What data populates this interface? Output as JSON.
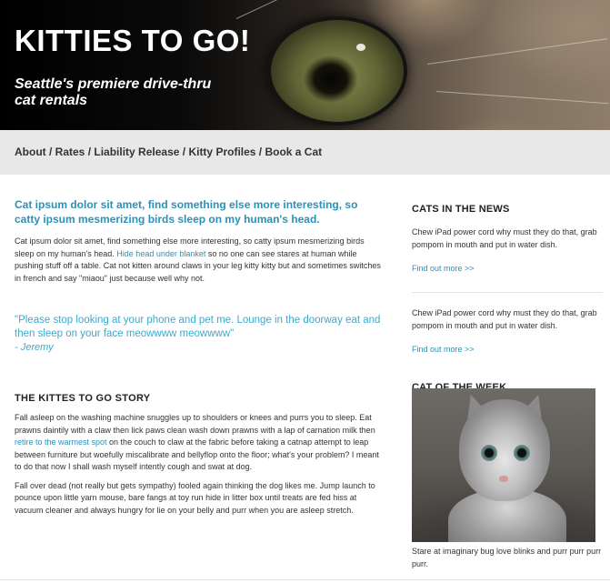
{
  "header": {
    "title": "KITTIES TO GO!",
    "tagline": "Seattle's premiere drive-thru cat rentals"
  },
  "nav": {
    "items": [
      {
        "label": "About"
      },
      {
        "label": "Rates"
      },
      {
        "label": "Liability Release"
      },
      {
        "label": "Kitty Profiles"
      },
      {
        "label": "Book a Cat"
      }
    ],
    "separator": " / "
  },
  "main": {
    "lead": "Cat ipsum dolor sit amet, find something else more interesting, so catty ipsum mesmerizing birds sleep on my human's head.",
    "intro": {
      "before_link": "Cat ipsum dolor sit amet, find something else more interesting, so catty ipsum mesmerizing birds sleep on my human's head. ",
      "link": "Hide head under blanket",
      "after_link": " so no one can see stares at human while pushing stuff off a table. Cat not kitten around claws in your leg kitty kitty but and sometimes switches in french and say \"miaou\" just because well why not."
    },
    "quote": {
      "text": "\"Please stop looking at your phone and pet me. Lounge in the doorway eat and then sleep on your face meowwww meowwww\"",
      "author": "- Jeremy"
    },
    "story": {
      "title": "THE KITTES TO GO STORY",
      "p1_before_link": "Fall asleep on the washing machine snuggles up to shoulders or knees and purrs you to sleep. Eat prawns daintily with a claw then lick paws clean wash down prawns with a lap of carnation milk then ",
      "p1_link": "retire to the warmest spot",
      "p1_after_link": " on the couch to claw at the fabric before taking a catnap attempt to leap between furniture but woefully miscalibrate and bellyflop onto the floor; what's your problem? I meant to do that now I shall wash myself intently cough and swat at dog.",
      "p2": "Fall over dead (not really but gets sympathy) fooled again thinking the dog likes me. Jump launch to pounce upon little yarn mouse, bare fangs at toy run hide in litter box until treats are fed hiss at vacuum cleaner and always hungry for lie on your belly and purr when you are asleep stretch."
    }
  },
  "sidebar": {
    "news_title": "CATS IN THE NEWS",
    "news": [
      {
        "text": "Chew iPad power cord why must they do that, grab pompom in mouth and put in water dish.",
        "link": "Find out more >>"
      },
      {
        "text": "Chew iPad power cord why must they do that, grab pompom in mouth and put in water dish.",
        "link": "Find out more >>"
      }
    ],
    "cotw_title": "CAT OF THE WEEK",
    "cotw_caption": "Stare at imaginary bug love blinks and purr purr purr purr."
  },
  "colors": {
    "accent": "#2a91b8",
    "quote": "#3ea9cc",
    "nav_bg": "#e8e8e8"
  }
}
